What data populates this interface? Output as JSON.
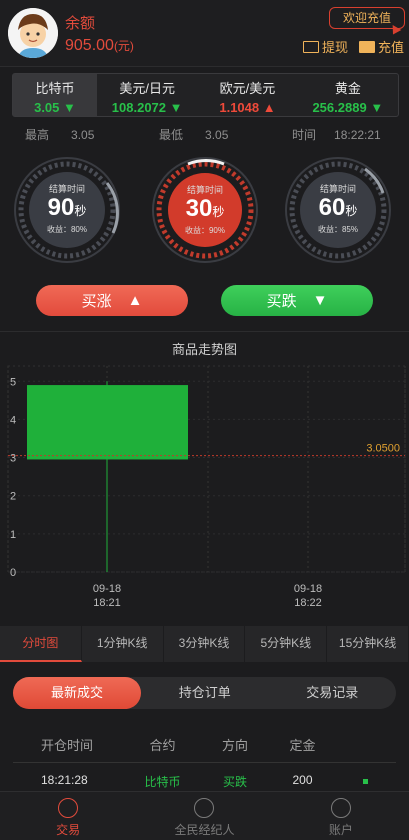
{
  "header": {
    "balance_label": "余额",
    "balance_value": "905.00",
    "balance_unit": "(元)",
    "welcome": "欢迎充值",
    "withdraw": "提现",
    "recharge": "充值"
  },
  "tickers": [
    {
      "name": "比特币",
      "price": "3.05",
      "dir": "▼"
    },
    {
      "name": "美元/日元",
      "price": "108.2072",
      "dir": "▼"
    },
    {
      "name": "欧元/美元",
      "price": "1.1048",
      "dir": "▲"
    },
    {
      "name": "黄金",
      "price": "256.2889",
      "dir": "▼"
    }
  ],
  "stats": {
    "high_label": "最高",
    "high": "3.05",
    "low_label": "最低",
    "low": "3.05",
    "time_label": "时间",
    "time": "18:22:21"
  },
  "gauges": [
    {
      "cap": "结算时间",
      "num": "90",
      "unit": "秒",
      "yield": "收益：80%"
    },
    {
      "cap": "结算时间",
      "num": "30",
      "unit": "秒",
      "yield": "收益：90%"
    },
    {
      "cap": "结算时间",
      "num": "60",
      "unit": "秒",
      "yield": "收益：85%"
    }
  ],
  "actions": {
    "buy_up": "买涨",
    "buy_up_icon": "▲",
    "buy_down": "买跌",
    "buy_down_icon": "▼"
  },
  "chart_title": "商品走势图",
  "chart_data": {
    "type": "candlestick",
    "title": "商品走势图",
    "yticks": [
      "0",
      "1",
      "2",
      "3",
      "4",
      "5"
    ],
    "ylim": [
      0,
      5.4
    ],
    "x_labels": [
      {
        "date": "09-18",
        "time": "18:21"
      },
      {
        "date": "09-18",
        "time": "18:22"
      }
    ],
    "candles": [
      {
        "time": "18:21",
        "open": 2.95,
        "close": 4.9,
        "high": 5.0,
        "low": 0
      }
    ],
    "last_price": 3.05,
    "last_price_label": "3.0500",
    "colors": {
      "candle": "#1fb03a",
      "last_line": "#c0392b",
      "last_label": "#e0a030"
    }
  },
  "ktabs": [
    "分时图",
    "1分钟K线",
    "3分钟K线",
    "5分钟K线",
    "15分钟K线"
  ],
  "segments": [
    "最新成交",
    "持仓订单",
    "交易记录"
  ],
  "table": {
    "headers": [
      "开仓时间",
      "合约",
      "方向",
      "定金"
    ],
    "rows": [
      {
        "time": "18:21:28",
        "contract": "比特币",
        "direction": "买跌",
        "amount": "200"
      }
    ]
  },
  "tabbar": [
    "交易",
    "全民经纪人",
    "账户"
  ]
}
